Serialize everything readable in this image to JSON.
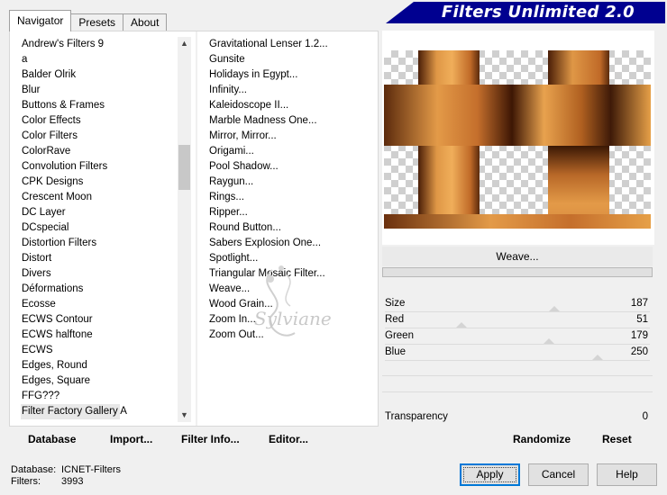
{
  "tabs": [
    {
      "label": "Navigator",
      "active": true
    },
    {
      "label": "Presets",
      "active": false
    },
    {
      "label": "About",
      "active": false
    }
  ],
  "title": "Filters Unlimited 2.0",
  "categories": [
    "Andrew's Filters 9",
    "a",
    "Balder Olrik",
    "Blur",
    "Buttons & Frames",
    "Color Effects",
    "Color Filters",
    "ColorRave",
    "Convolution Filters",
    "CPK Designs",
    "Crescent Moon",
    "DC Layer",
    "DCspecial",
    "Distortion Filters",
    "Distort",
    "Divers",
    "Déformations",
    "Ecosse",
    "ECWS Contour",
    "ECWS halftone",
    "ECWS",
    "Edges, Round",
    "Edges, Square",
    "FFG???",
    "Filter Factory Gallery A"
  ],
  "selected_category": "Filter Factory Gallery A",
  "filters": [
    "Gravitational Lenser 1.2...",
    "Gunsite",
    "Holidays in Egypt...",
    "Infinity...",
    "Kaleidoscope II...",
    "Marble Madness One...",
    "Mirror, Mirror...",
    "Origami...",
    "Pool Shadow...",
    "Raygun...",
    "Rings...",
    "Ripper...",
    "Round Button...",
    "Sabers Explosion One...",
    "Spotlight...",
    "Triangular Mosaic Filter...",
    "Weave...",
    "Wood Grain...",
    "Zoom In...",
    "Zoom Out..."
  ],
  "buttons": {
    "database": "Database",
    "import": "Import...",
    "filter_info": "Filter Info...",
    "editor": "Editor...",
    "randomize": "Randomize",
    "reset": "Reset",
    "apply": "Apply",
    "cancel": "Cancel",
    "help": "Help"
  },
  "current_filter": "Weave...",
  "params": {
    "size": {
      "label": "Size",
      "value": "187",
      "fraction": 0.733
    },
    "red": {
      "label": "Red",
      "value": "51",
      "fraction": 0.2
    },
    "green": {
      "label": "Green",
      "value": "179",
      "fraction": 0.702
    },
    "blue": {
      "label": "Blue",
      "value": "250",
      "fraction": 0.98
    },
    "transparency": {
      "label": "Transparency",
      "value": "0"
    }
  },
  "status": {
    "database_label": "Database:",
    "database_value": "ICNET-Filters",
    "filters_label": "Filters:",
    "filters_value": "3993"
  },
  "watermark": "Sylviane",
  "colors": {
    "banner": "#000090",
    "accent": "#0078d7"
  }
}
